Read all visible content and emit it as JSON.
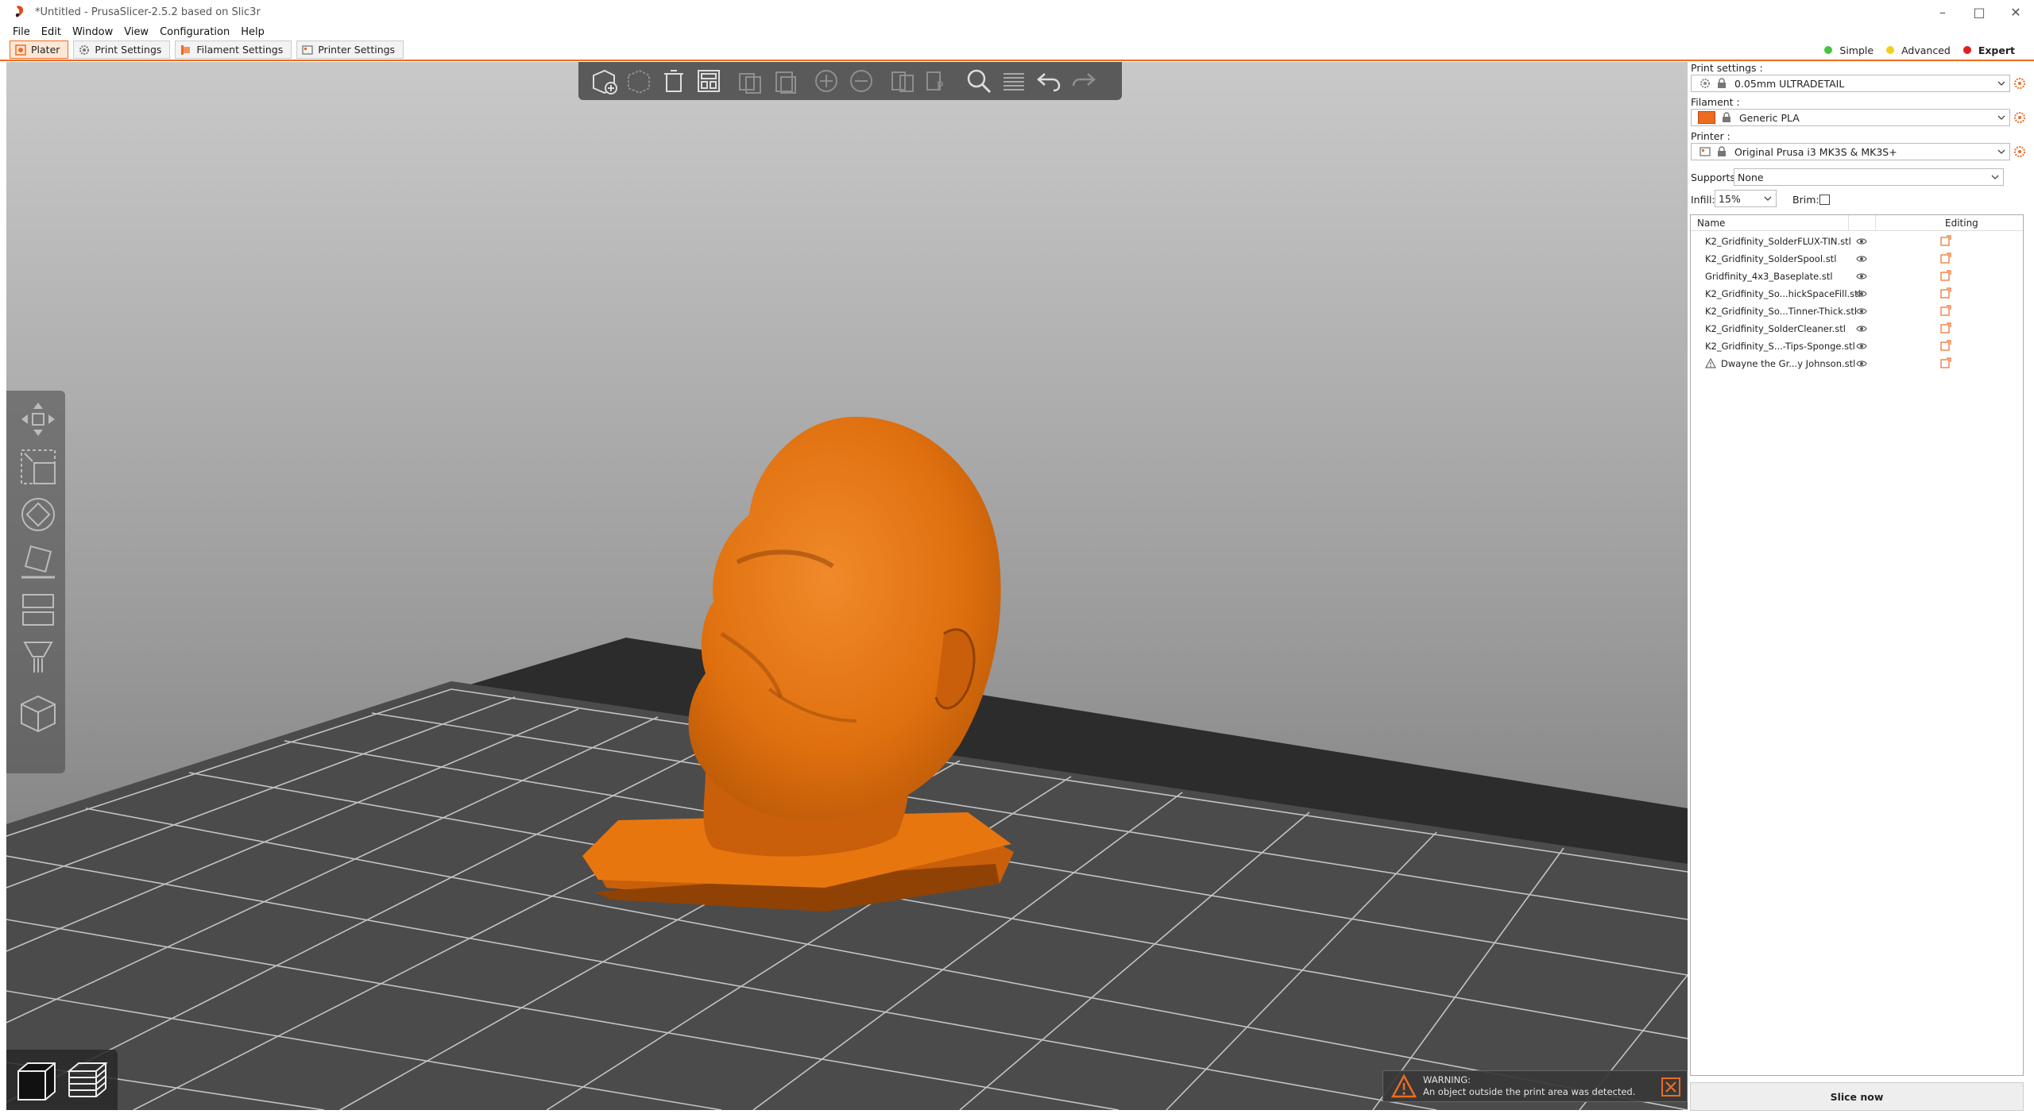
{
  "window": {
    "title": "*Untitled - PrusaSlicer-2.5.2 based on Slic3r"
  },
  "menu": [
    "File",
    "Edit",
    "Window",
    "View",
    "Configuration",
    "Help"
  ],
  "tabs": [
    {
      "label": "Plater",
      "icon": "plater-icon",
      "active": true
    },
    {
      "label": "Print Settings",
      "icon": "gear-icon",
      "active": false
    },
    {
      "label": "Filament Settings",
      "icon": "spool-icon",
      "active": false
    },
    {
      "label": "Printer Settings",
      "icon": "printer-icon",
      "active": false
    }
  ],
  "modes": [
    {
      "label": "Simple",
      "color": "#47C43E"
    },
    {
      "label": "Advanced",
      "color": "#F1D11E"
    },
    {
      "label": "Expert",
      "color": "#E41D1D",
      "active": true
    }
  ],
  "sidebar": {
    "print_settings_label": "Print settings :",
    "print_settings_value": "0.05mm ULTRADETAIL",
    "filament_label": "Filament :",
    "filament_value": "Generic PLA",
    "filament_color": "#ED6B21",
    "printer_label": "Printer :",
    "printer_value": "Original Prusa i3 MK3S & MK3S+",
    "supports_label": "Supports:",
    "supports_value": "None",
    "infill_label": "Infill:",
    "infill_value": "15%",
    "brim_label": "Brim:",
    "brim_checked": false
  },
  "object_list": {
    "col_name": "Name",
    "col_editing": "Editing",
    "rows": [
      {
        "name": "K2_Gridfinity_SolderFLUX-TIN.stl",
        "warning": false
      },
      {
        "name": "K2_Gridfinity_SolderSpool.stl",
        "warning": false
      },
      {
        "name": "Gridfinity_4x3_Baseplate.stl",
        "warning": false
      },
      {
        "name": "K2_Gridfinity_So...hickSpaceFill.stl",
        "warning": false
      },
      {
        "name": "K2_Gridfinity_So...Tinner-Thick.stl",
        "warning": false
      },
      {
        "name": "K2_Gridfinity_SolderCleaner.stl",
        "warning": false
      },
      {
        "name": "K2_Gridfinity_S...-Tips-Sponge.stl",
        "warning": false
      },
      {
        "name": "Dwayne the Gr...y Johnson.stl",
        "warning": true
      }
    ]
  },
  "slice_button": "Slice now",
  "warning": {
    "title": "WARNING:",
    "message": "An object outside the print area was detected."
  },
  "colors": {
    "accent": "#ED6B21",
    "model": "#E8730C",
    "viewport_top": "#c8c8c8",
    "viewport_bottom": "#6a6a6a"
  }
}
